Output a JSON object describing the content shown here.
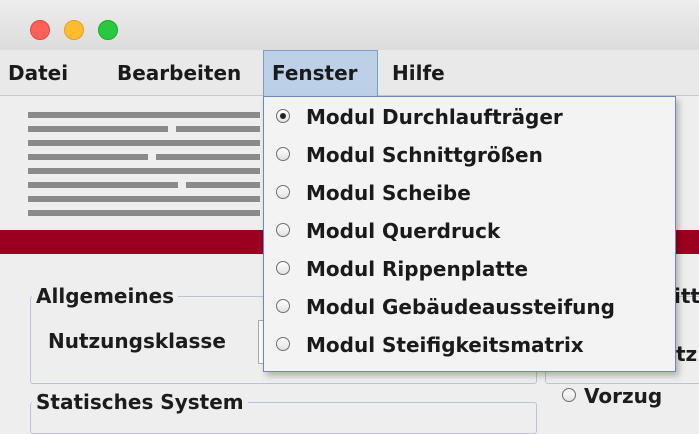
{
  "menubar": {
    "items": [
      {
        "label": "Datei"
      },
      {
        "label": "Bearbeiten"
      },
      {
        "label": "Fenster"
      },
      {
        "label": "Hilfe"
      }
    ]
  },
  "fenster_menu": {
    "items": [
      {
        "label": "Modul Durchlaufträger",
        "selected": true
      },
      {
        "label": "Modul Schnittgrößen",
        "selected": false
      },
      {
        "label": "Modul Scheibe",
        "selected": false
      },
      {
        "label": "Modul Querdruck",
        "selected": false
      },
      {
        "label": "Modul Rippenplatte",
        "selected": false
      },
      {
        "label": "Modul Gebäudeaussteifung",
        "selected": false
      },
      {
        "label": "Modul Steifigkeitsmatrix",
        "selected": false
      }
    ]
  },
  "main": {
    "allgemeines_legend": "Allgemeines",
    "nutzungsklasse_label": "Nutzungsklasse",
    "statisches_system_legend": "Statisches System",
    "right_fragment_1": "itt",
    "right_fragment_2": "tz",
    "vorzug_label": "Vorzug"
  },
  "colors": {
    "brand_band": "#9b0020",
    "menu_highlight": "#bcd1e8"
  }
}
